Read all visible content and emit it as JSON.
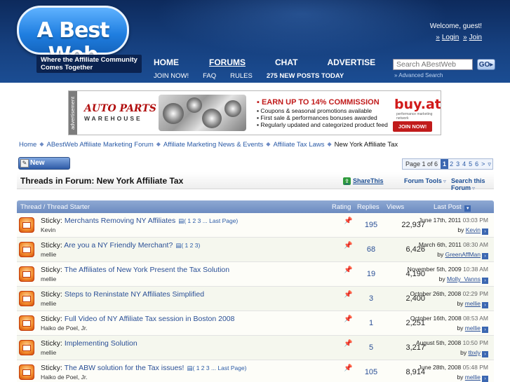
{
  "header": {
    "logo_text": "A Best Web",
    "tagline": "Where the Affiliate Community Comes Together",
    "welcome": "Welcome, guest!",
    "login": "Login",
    "join": "Join",
    "nav_main": [
      "HOME",
      "FORUMS",
      "CHAT",
      "ADVERTISE"
    ],
    "nav_sub": [
      "JOIN NOW!",
      "FAQ",
      "RULES",
      "275 NEW POSTS TODAY"
    ],
    "search_placeholder": "Search ABestWeb",
    "search_button": "GO",
    "advanced_search": "» Advanced Search"
  },
  "ad": {
    "label": "advertisement",
    "brand_top": "AUTO PARTS",
    "brand_bottom": "WAREHOUSE",
    "headline": "▪ EARN UP TO 14% COMMISSION",
    "bullets": [
      "▪ Coupons & seasonal promotions available",
      "▪ First sale & performances bonuses awarded",
      "▪ Regularly updated and categorized product feed"
    ],
    "network": "buy.at",
    "network_tag": "performance marketing network",
    "join": "JOIN NOW!"
  },
  "breadcrumb": [
    "Home",
    "ABestWeb Affiliate Marketing Forum",
    "Affiliate Marketing News & Events",
    "Affiliate Tax Laws",
    "New York Affiliate Tax"
  ],
  "toolbar": {
    "new_thread": "New Thread",
    "page_label": "Page 1 of 6",
    "pages": [
      "1",
      "2",
      "3",
      "4",
      "5",
      "6",
      ">"
    ]
  },
  "forum": {
    "title": "Threads in Forum: New York Affiliate Tax",
    "share": "ShareThis",
    "tools": "Forum Tools",
    "search": "Search this Forum"
  },
  "table": {
    "headers": {
      "thread": "Thread / Thread Starter",
      "rating": "Rating",
      "replies": "Replies",
      "views": "Views",
      "last": "Last Post"
    },
    "rows": [
      {
        "prefix": "Sticky:",
        "title": "Merchants Removing NY Affiliates",
        "pages": "( 1 2 3 ... Last Page)",
        "starter": "Kevin",
        "replies": "195",
        "views": "22,937",
        "date": "June 17th, 2011",
        "time": "03:03 PM",
        "by": "by",
        "user": "Kevin"
      },
      {
        "prefix": "Sticky:",
        "title": "Are you a NY Friendly Merchant?",
        "pages": "( 1 2 3)",
        "starter": "mellie",
        "replies": "68",
        "views": "6,426",
        "date": "March 6th, 2011",
        "time": "08:30 AM",
        "by": "by",
        "user": "GreenAffMan"
      },
      {
        "prefix": "Sticky:",
        "title": "The Affiliates of New York Present the Tax Solution",
        "pages": "",
        "starter": "mellie",
        "replies": "19",
        "views": "4,190",
        "date": "November 5th, 2009",
        "time": "10:38 AM",
        "by": "by",
        "user": "Molly_Vanns"
      },
      {
        "prefix": "Sticky:",
        "title": "Steps to Reninstate NY Affiliates Simplified",
        "pages": "",
        "starter": "mellie",
        "replies": "3",
        "views": "2,400",
        "date": "October 26th, 2008",
        "time": "02:29 PM",
        "by": "by",
        "user": "mellie"
      },
      {
        "prefix": "Sticky:",
        "title": "Full Video of NY Affiliate Tax session in Boston 2008",
        "pages": "",
        "starter": "Haiko de Poel, Jr.",
        "replies": "1",
        "views": "2,251",
        "date": "October 16th, 2008",
        "time": "08:53 AM",
        "by": "by",
        "user": "mellie"
      },
      {
        "prefix": "Sticky:",
        "title": "Implementing Solution",
        "pages": "",
        "starter": "mellie",
        "replies": "5",
        "views": "3,217",
        "date": "August 5th, 2008",
        "time": "10:50 PM",
        "by": "by",
        "user": "tbxly"
      },
      {
        "prefix": "Sticky:",
        "title": "The ABW solution for the Tax issues!",
        "pages": "( 1 2 3 ... Last Page)",
        "starter": "Haiko de Poel, Jr.",
        "replies": "105",
        "views": "8,914",
        "date": "June 28th, 2008",
        "time": "05:48 PM",
        "by": "by",
        "user": "mellie"
      }
    ]
  }
}
